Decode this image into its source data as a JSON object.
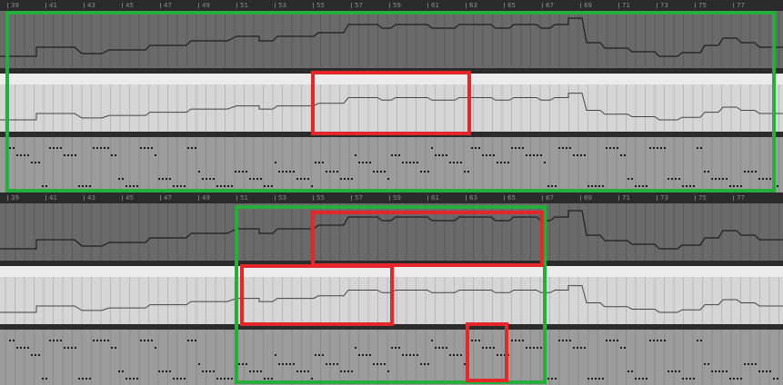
{
  "ruler": {
    "bars": [
      "39",
      "41",
      "43",
      "45",
      "47",
      "49",
      "51",
      "53",
      "55",
      "57",
      "59",
      "61",
      "63",
      "65",
      "67",
      "69",
      "71",
      "73",
      "75",
      "77"
    ]
  },
  "colors": {
    "lane_dark_bg": "#6a6a6a",
    "lane_light_bg": "#d6d6d6",
    "lane_mid_bg": "#9c9c9c",
    "highlight_green": "#26ad3c",
    "highlight_red": "#e5262a",
    "separator": "#2b2b2b"
  },
  "panels": [
    {
      "id": "top",
      "highlights": [
        {
          "kind": "green",
          "label": "full-region"
        },
        {
          "kind": "red",
          "label": "selected-segment"
        }
      ]
    },
    {
      "id": "bottom",
      "highlights": [
        {
          "kind": "green",
          "label": "selection-range"
        },
        {
          "kind": "red",
          "label": "dark-lane-segment"
        },
        {
          "kind": "red",
          "label": "light-lane-segment"
        },
        {
          "kind": "red",
          "label": "dotted-lane-segment"
        }
      ]
    }
  ]
}
